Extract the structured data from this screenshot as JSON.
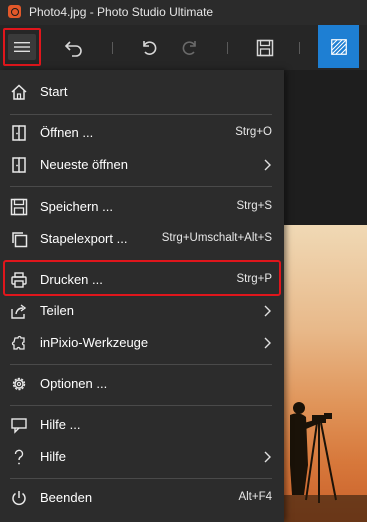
{
  "window": {
    "title": "Photo4.jpg - Photo Studio Ultimate"
  },
  "toolbar": {
    "menu_icon": "hamburger-icon",
    "undo_icon": "undo-icon",
    "undo2_icon": "undo-step-icon",
    "redo_icon": "redo-icon",
    "save_icon": "save-icon",
    "tool_icon": "pattern-tool-icon",
    "accent_color": "#1e7fd3",
    "highlight_color": "#e0161c"
  },
  "menu": {
    "items": [
      {
        "label": "Start",
        "shortcut": "",
        "icon": "home-icon",
        "submenu": false
      },
      {
        "label": "Öffnen ...",
        "shortcut": "Strg+O",
        "icon": "open-icon",
        "submenu": false
      },
      {
        "label": "Neueste öffnen",
        "shortcut": "",
        "icon": "recent-open-icon",
        "submenu": true
      },
      {
        "label": "Speichern ...",
        "shortcut": "Strg+S",
        "icon": "save-icon",
        "submenu": false
      },
      {
        "label": "Stapelexport ...",
        "shortcut": "Strg+Umschalt+Alt+S",
        "icon": "batch-export-icon",
        "submenu": false
      },
      {
        "label": "Drucken ...",
        "shortcut": "Strg+P",
        "icon": "printer-icon",
        "submenu": false
      },
      {
        "label": "Teilen",
        "shortcut": "",
        "icon": "share-icon",
        "submenu": true
      },
      {
        "label": "inPixio-Werkzeuge",
        "shortcut": "",
        "icon": "puzzle-icon",
        "submenu": true
      },
      {
        "label": "Optionen ...",
        "shortcut": "",
        "icon": "gear-icon",
        "submenu": false
      },
      {
        "label": "Hilfe ...",
        "shortcut": "",
        "icon": "help-chat-icon",
        "submenu": false
      },
      {
        "label": "Hilfe",
        "shortcut": "",
        "icon": "question-mark-icon",
        "submenu": true
      },
      {
        "label": "Beenden",
        "shortcut": "Alt+F4",
        "icon": "power-icon",
        "submenu": false
      }
    ]
  }
}
